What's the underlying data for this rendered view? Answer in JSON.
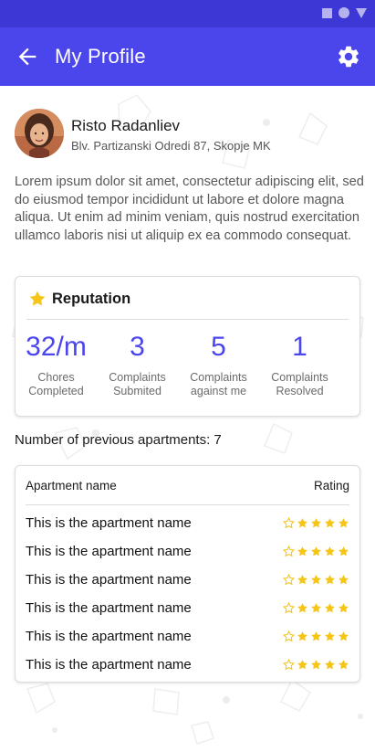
{
  "header": {
    "title": "My Profile",
    "back_icon": "arrow-left-icon",
    "settings_icon": "gear-icon",
    "color": "#4b45ec",
    "status_color": "#3d37d6"
  },
  "profile": {
    "name": "Risto Radanliev",
    "address": "Blv. Partizanski Odredi 87, Skopje MK",
    "bio": "Lorem ipsum dolor sit amet, consectetur adipiscing elit, sed do eiusmod tempor incididunt ut labore et dolore magna aliqua. Ut enim ad minim veniam, quis nostrud exercitation ullamco laboris nisi ut aliquip ex ea commodo consequat."
  },
  "reputation": {
    "title": "Reputation",
    "icon": "star-icon",
    "stats": [
      {
        "value": "32/m",
        "label1": "Chores",
        "label2": "Completed"
      },
      {
        "value": "3",
        "label1": "Complaints",
        "label2": "Submited"
      },
      {
        "value": "5",
        "label1": "Complaints",
        "label2": "against me"
      },
      {
        "value": "1",
        "label1": "Complaints",
        "label2": "Resolved"
      }
    ]
  },
  "apartments": {
    "count_label": "Number of previous apartments: 7",
    "header_name": "Apartment name",
    "header_rating": "Rating",
    "rows": [
      {
        "name": "This is the apartment name",
        "rating": 4
      },
      {
        "name": "This is the apartment name",
        "rating": 4
      },
      {
        "name": "This is the apartment name",
        "rating": 4
      },
      {
        "name": "This is the apartment name",
        "rating": 4
      },
      {
        "name": "This is the apartment name",
        "rating": 4
      },
      {
        "name": "This is the apartment name",
        "rating": 4
      }
    ],
    "max_rating": 5,
    "star_color": "#f5c518"
  }
}
